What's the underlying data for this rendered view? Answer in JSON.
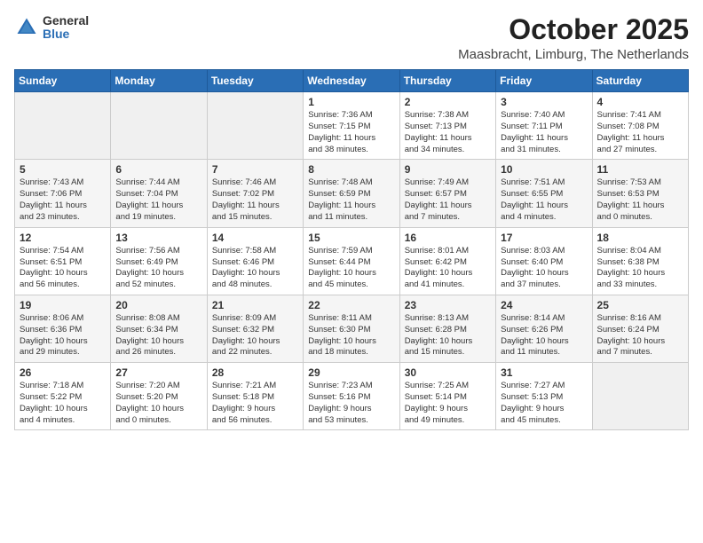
{
  "header": {
    "logo_general": "General",
    "logo_blue": "Blue",
    "month_title": "October 2025",
    "location": "Maasbracht, Limburg, The Netherlands"
  },
  "weekdays": [
    "Sunday",
    "Monday",
    "Tuesday",
    "Wednesday",
    "Thursday",
    "Friday",
    "Saturday"
  ],
  "weeks": [
    [
      {
        "day": "",
        "info": ""
      },
      {
        "day": "",
        "info": ""
      },
      {
        "day": "",
        "info": ""
      },
      {
        "day": "1",
        "info": "Sunrise: 7:36 AM\nSunset: 7:15 PM\nDaylight: 11 hours\nand 38 minutes."
      },
      {
        "day": "2",
        "info": "Sunrise: 7:38 AM\nSunset: 7:13 PM\nDaylight: 11 hours\nand 34 minutes."
      },
      {
        "day": "3",
        "info": "Sunrise: 7:40 AM\nSunset: 7:11 PM\nDaylight: 11 hours\nand 31 minutes."
      },
      {
        "day": "4",
        "info": "Sunrise: 7:41 AM\nSunset: 7:08 PM\nDaylight: 11 hours\nand 27 minutes."
      }
    ],
    [
      {
        "day": "5",
        "info": "Sunrise: 7:43 AM\nSunset: 7:06 PM\nDaylight: 11 hours\nand 23 minutes."
      },
      {
        "day": "6",
        "info": "Sunrise: 7:44 AM\nSunset: 7:04 PM\nDaylight: 11 hours\nand 19 minutes."
      },
      {
        "day": "7",
        "info": "Sunrise: 7:46 AM\nSunset: 7:02 PM\nDaylight: 11 hours\nand 15 minutes."
      },
      {
        "day": "8",
        "info": "Sunrise: 7:48 AM\nSunset: 6:59 PM\nDaylight: 11 hours\nand 11 minutes."
      },
      {
        "day": "9",
        "info": "Sunrise: 7:49 AM\nSunset: 6:57 PM\nDaylight: 11 hours\nand 7 minutes."
      },
      {
        "day": "10",
        "info": "Sunrise: 7:51 AM\nSunset: 6:55 PM\nDaylight: 11 hours\nand 4 minutes."
      },
      {
        "day": "11",
        "info": "Sunrise: 7:53 AM\nSunset: 6:53 PM\nDaylight: 11 hours\nand 0 minutes."
      }
    ],
    [
      {
        "day": "12",
        "info": "Sunrise: 7:54 AM\nSunset: 6:51 PM\nDaylight: 10 hours\nand 56 minutes."
      },
      {
        "day": "13",
        "info": "Sunrise: 7:56 AM\nSunset: 6:49 PM\nDaylight: 10 hours\nand 52 minutes."
      },
      {
        "day": "14",
        "info": "Sunrise: 7:58 AM\nSunset: 6:46 PM\nDaylight: 10 hours\nand 48 minutes."
      },
      {
        "day": "15",
        "info": "Sunrise: 7:59 AM\nSunset: 6:44 PM\nDaylight: 10 hours\nand 45 minutes."
      },
      {
        "day": "16",
        "info": "Sunrise: 8:01 AM\nSunset: 6:42 PM\nDaylight: 10 hours\nand 41 minutes."
      },
      {
        "day": "17",
        "info": "Sunrise: 8:03 AM\nSunset: 6:40 PM\nDaylight: 10 hours\nand 37 minutes."
      },
      {
        "day": "18",
        "info": "Sunrise: 8:04 AM\nSunset: 6:38 PM\nDaylight: 10 hours\nand 33 minutes."
      }
    ],
    [
      {
        "day": "19",
        "info": "Sunrise: 8:06 AM\nSunset: 6:36 PM\nDaylight: 10 hours\nand 29 minutes."
      },
      {
        "day": "20",
        "info": "Sunrise: 8:08 AM\nSunset: 6:34 PM\nDaylight: 10 hours\nand 26 minutes."
      },
      {
        "day": "21",
        "info": "Sunrise: 8:09 AM\nSunset: 6:32 PM\nDaylight: 10 hours\nand 22 minutes."
      },
      {
        "day": "22",
        "info": "Sunrise: 8:11 AM\nSunset: 6:30 PM\nDaylight: 10 hours\nand 18 minutes."
      },
      {
        "day": "23",
        "info": "Sunrise: 8:13 AM\nSunset: 6:28 PM\nDaylight: 10 hours\nand 15 minutes."
      },
      {
        "day": "24",
        "info": "Sunrise: 8:14 AM\nSunset: 6:26 PM\nDaylight: 10 hours\nand 11 minutes."
      },
      {
        "day": "25",
        "info": "Sunrise: 8:16 AM\nSunset: 6:24 PM\nDaylight: 10 hours\nand 7 minutes."
      }
    ],
    [
      {
        "day": "26",
        "info": "Sunrise: 7:18 AM\nSunset: 5:22 PM\nDaylight: 10 hours\nand 4 minutes."
      },
      {
        "day": "27",
        "info": "Sunrise: 7:20 AM\nSunset: 5:20 PM\nDaylight: 10 hours\nand 0 minutes."
      },
      {
        "day": "28",
        "info": "Sunrise: 7:21 AM\nSunset: 5:18 PM\nDaylight: 9 hours\nand 56 minutes."
      },
      {
        "day": "29",
        "info": "Sunrise: 7:23 AM\nSunset: 5:16 PM\nDaylight: 9 hours\nand 53 minutes."
      },
      {
        "day": "30",
        "info": "Sunrise: 7:25 AM\nSunset: 5:14 PM\nDaylight: 9 hours\nand 49 minutes."
      },
      {
        "day": "31",
        "info": "Sunrise: 7:27 AM\nSunset: 5:13 PM\nDaylight: 9 hours\nand 45 minutes."
      },
      {
        "day": "",
        "info": ""
      }
    ]
  ]
}
